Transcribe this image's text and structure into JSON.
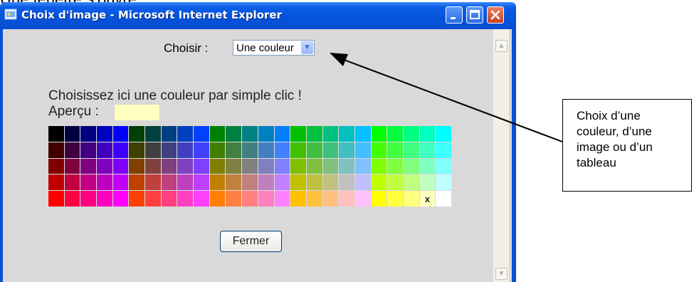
{
  "document": {
    "partial_heading": "Une fenêtre s’ouvre :"
  },
  "window": {
    "title": "Choix d'image - Microsoft Internet Explorer",
    "choose_label": "Choisir :",
    "select_value": "Une couleur",
    "prompt": "Choisissez ici une couleur par simple clic !",
    "preview_label": "Aperçu :",
    "preview_color": "#ffffc0",
    "close_button": "Fermer",
    "palette_mark": "x",
    "palette": [
      [
        "#000000",
        "#000040",
        "#000080",
        "#0000c0",
        "#0000ff",
        "#004000",
        "#004040",
        "#004080",
        "#0040c0",
        "#0040ff",
        "#008000",
        "#008040",
        "#008080",
        "#0080c0",
        "#0080ff",
        "#00c000",
        "#00c040",
        "#00c080",
        "#00c0c0",
        "#00c0ff",
        "#00ff00",
        "#00ff40",
        "#00ff80",
        "#00ffc0",
        "#00ffff"
      ],
      [
        "#400000",
        "#400040",
        "#400080",
        "#4000c0",
        "#4000ff",
        "#404000",
        "#404040",
        "#404080",
        "#4040c0",
        "#4040ff",
        "#408000",
        "#408040",
        "#408080",
        "#4080c0",
        "#4080ff",
        "#40c000",
        "#40c040",
        "#40c080",
        "#40c0c0",
        "#40c0ff",
        "#40ff00",
        "#40ff40",
        "#40ff80",
        "#40ffc0",
        "#40ffff"
      ],
      [
        "#800000",
        "#800040",
        "#800080",
        "#8000c0",
        "#8000ff",
        "#804000",
        "#804040",
        "#804080",
        "#8040c0",
        "#8040ff",
        "#808000",
        "#808040",
        "#808080",
        "#8080c0",
        "#8080ff",
        "#80c000",
        "#80c040",
        "#80c080",
        "#80c0c0",
        "#80c0ff",
        "#80ff00",
        "#80ff40",
        "#80ff80",
        "#80ffc0",
        "#80ffff"
      ],
      [
        "#c00000",
        "#c00040",
        "#c00080",
        "#c000c0",
        "#c000ff",
        "#c04000",
        "#c04040",
        "#c04080",
        "#c040c0",
        "#c040ff",
        "#c08000",
        "#c08040",
        "#c08080",
        "#c080c0",
        "#c080ff",
        "#c0c000",
        "#c0c040",
        "#c0c080",
        "#c0c0c0",
        "#c0c0ff",
        "#c0ff00",
        "#c0ff40",
        "#c0ff80",
        "#c0ffc0",
        "#c0ffff"
      ],
      [
        "#ff0000",
        "#ff0040",
        "#ff0080",
        "#ff00c0",
        "#ff00ff",
        "#ff4000",
        "#ff4040",
        "#ff4080",
        "#ff40c0",
        "#ff40ff",
        "#ff8000",
        "#ff8040",
        "#ff8080",
        "#ff80c0",
        "#ff80ff",
        "#ffc000",
        "#ffc040",
        "#ffc080",
        "#ffc0c0",
        "#ffc0ff",
        "#ffff00",
        "#ffff40",
        "#ffff80",
        "#ffffc0",
        "#ffffff"
      ]
    ]
  },
  "callout": {
    "lines": [
      "Choix d’une",
      "couleur, d’une",
      "image ou d’un",
      "tableau"
    ]
  },
  "colors": {
    "titlebar": "#0a5ee6",
    "client_bg": "#d9d9d9",
    "callout_border": "#000000"
  }
}
